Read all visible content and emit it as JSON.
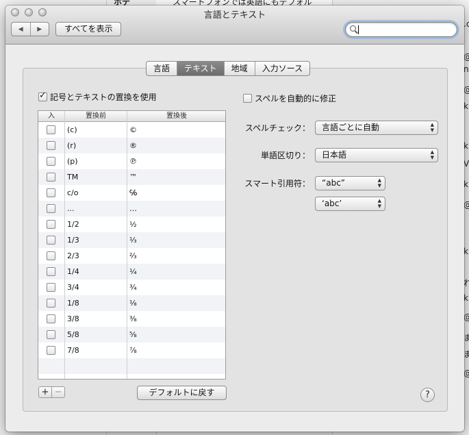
{
  "window": {
    "title": "言語とテキスト",
    "show_all": "すべてを表示",
    "search": {
      "value": "",
      "placeholder": ""
    }
  },
  "background": {
    "texts": [
      "スマートフォンでは英語にもデフォル",
      "ホテ",
      ".c",
      "@",
      "@",
      "k",
      "nl",
      "k",
      "V",
      "k",
      "@",
      "k",
      "れ",
      "k",
      "@",
      "ま",
      "ま",
      "@"
    ]
  },
  "tabs": [
    {
      "label": "言語",
      "active": false
    },
    {
      "label": "テキスト",
      "active": true
    },
    {
      "label": "地域",
      "active": false
    },
    {
      "label": "入力ソース",
      "active": false
    }
  ],
  "replace": {
    "checkbox_label": "記号とテキストの置換を使用",
    "checked": true
  },
  "table": {
    "headers": [
      "入",
      "置換前",
      "置換後"
    ],
    "rows": [
      {
        "from": "(c)",
        "to": "©"
      },
      {
        "from": "(r)",
        "to": "®"
      },
      {
        "from": "(p)",
        "to": "℗"
      },
      {
        "from": "TM",
        "to": "™"
      },
      {
        "from": "c/o",
        "to": "℅"
      },
      {
        "from": "...",
        "to": "…"
      },
      {
        "from": "1/2",
        "to": "½"
      },
      {
        "from": "1/3",
        "to": "⅓"
      },
      {
        "from": "2/3",
        "to": "⅔"
      },
      {
        "from": "1/4",
        "to": "¼"
      },
      {
        "from": "3/4",
        "to": "¾"
      },
      {
        "from": "1/8",
        "to": "⅛"
      },
      {
        "from": "3/8",
        "to": "⅜"
      },
      {
        "from": "5/8",
        "to": "⅝"
      },
      {
        "from": "7/8",
        "to": "⅞"
      }
    ]
  },
  "buttons": {
    "add": "+",
    "remove": "−",
    "restore_defaults": "デフォルトに戻す",
    "help": "?"
  },
  "spelling": {
    "autocorrect_label": "スペルを自動的に修正",
    "autocorrect_checked": false,
    "spellcheck_label": "スペルチェック：",
    "spellcheck_value": "言語ごとに自動",
    "word_break_label": "単語区切り：",
    "word_break_value": "日本語",
    "smart_quotes_label": "スマート引用符：",
    "double_quote_value": "“abc”",
    "single_quote_value": "‘abc’"
  },
  "icons": {
    "back": "triangle-left",
    "forward": "triangle-right",
    "search": "magnifier",
    "popup": "up-down-arrows"
  }
}
